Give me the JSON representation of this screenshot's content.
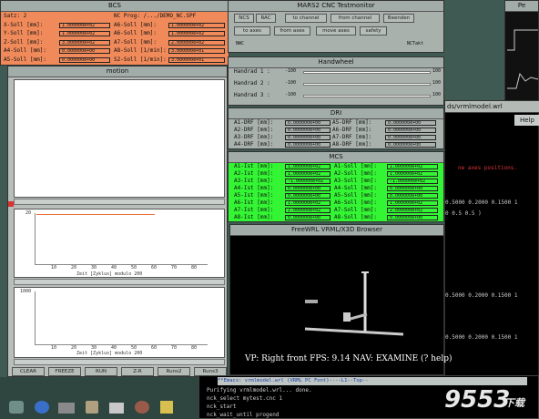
{
  "bcs": {
    "title": "BCS",
    "rows": [
      {
        "l1": "Satz: 2",
        "v1": "",
        "l2": "NC Prog: /.../DEMO_NC.SPF",
        "v2": ""
      },
      {
        "l1": "X-Soll [mm]:",
        "v1": "1.000000e+02",
        "l2": "A6-Soll [mm]:",
        "v2": "1.000000e+02"
      },
      {
        "l1": "Y-Soll [mm]:",
        "v1": "1.000000e+02",
        "l2": "A6-Soll [mm]:",
        "v2": "1.000000e+02"
      },
      {
        "l1": "Z-Soll [mm]:",
        "v1": "3.000000e+02",
        "l2": "A7-Soll [mm]:",
        "v2": "2.000000e+02"
      },
      {
        "l1": "A4-Soll [mm]:",
        "v1": "0.000000e+00",
        "l2": "A8-Soll [1/min]:",
        "v2": "3.000000e+01"
      },
      {
        "l1": "A5-Soll [mm]:",
        "v1": "0.000000e+00",
        "l2": "S2-Soll [1/min]:",
        "v2": "3.000000e+01"
      }
    ]
  },
  "testmonitor": {
    "title": "MARS2 CNC Testmonitor",
    "buttons_row1": [
      "NCS",
      "RAC",
      "to channel",
      "from channel",
      "Beenden"
    ],
    "buttons_row2": [
      "to axes",
      "from axes",
      "move axes",
      "safety"
    ],
    "corner_left": "NWC",
    "corner_right": "NCTakt"
  },
  "handwheel": {
    "title": "Handwheel",
    "rows": [
      {
        "label": "Handrad 1 :",
        "min": "-100",
        "max": "100"
      },
      {
        "label": "Handrad 2 :",
        "min": "-100",
        "max": "100"
      },
      {
        "label": "Handrad 3 :",
        "min": "-100",
        "max": "100"
      }
    ]
  },
  "dri": {
    "title": "DRI",
    "rows": [
      {
        "l1": "A1-DRF [mm]:",
        "v1": "0.000000e+00",
        "l2": "A5-DRF [mm]:",
        "v2": "0.000000e+00"
      },
      {
        "l1": "A2-DRF [mm]:",
        "v1": "0.000000e+00",
        "l2": "A6-DRF [mm]:",
        "v2": "0.000000e+00"
      },
      {
        "l1": "A3-DRF [mm]:",
        "v1": "0.000000e+00",
        "l2": "A7-DRF [mm]:",
        "v2": "0.000000e+00"
      },
      {
        "l1": "A4-DRF [mm]:",
        "v1": "0.000000e+00",
        "l2": "A8-DRF [mm]:",
        "v2": "0.000000e+00"
      }
    ]
  },
  "mcs": {
    "title": "MCS",
    "rows": [
      {
        "l1": "A1-Ist [mm]:",
        "v1": "1.000000e+02",
        "l2": "A1-Soll [mm]:",
        "v2": "1.000000e+02"
      },
      {
        "l1": "A2-Ist [mm]:",
        "v1": "1.000000e+02",
        "l2": "A2-Soll [mm]:",
        "v2": "1.000000e+02"
      },
      {
        "l1": "A3-Ist [mm]:",
        "v1": "-1.000000e+02",
        "l2": "A3-Soll [mm]:",
        "v2": "-1.000000e+02"
      },
      {
        "l1": "A4-Ist [mm]:",
        "v1": "0.000000e+00",
        "l2": "A4-Soll [mm]:",
        "v2": "0.000000e+00"
      },
      {
        "l1": "A5-Ist [mm]:",
        "v1": "0.000000e+00",
        "l2": "A5-Soll [mm]:",
        "v2": "0.000000e+00"
      },
      {
        "l1": "A6-Ist [mm]:",
        "v1": "1.000000e+02",
        "l2": "A6-Soll [mm]:",
        "v2": "1.000000e+02"
      },
      {
        "l1": "A7-Ist [mm]:",
        "v1": "2.000000e+02",
        "l2": "A7-Soll [mm]:",
        "v2": "2.000000e+02"
      },
      {
        "l1": "A8-Ist [mm]:",
        "v1": "0.000000e+00",
        "l2": "A8-Soll [mm]:",
        "v2": "0.000000e+00"
      }
    ]
  },
  "motion": {
    "title": "motion",
    "plot1": {
      "xlabel": "Zeit [Zyklus] modulo 200",
      "xticks": [
        "10",
        "20",
        "30",
        "40",
        "50",
        "60",
        "70",
        "80"
      ],
      "ytick": "20"
    },
    "plot2": {
      "xlabel": "Zeit [Zyklus] modulo 200",
      "xticks": [
        "10",
        "20",
        "30",
        "40",
        "50",
        "60",
        "70",
        "80"
      ],
      "ytick": "1000"
    },
    "bottom_buttons": [
      "CLEAR",
      "FREEZE",
      "RUN",
      "Z-R",
      "Runs2",
      "Runs3"
    ]
  },
  "vrml": {
    "title": "FreeWRL VRML/X3D Browser",
    "status": "VP: Right front   FPS: 9.14  NAV: EXAMINE  (? help)"
  },
  "rightpanel": {
    "title_fragment": "ds/vrmlmodel.wrl",
    "help": "Help",
    "red_text": "ne axes positions.",
    "lines": [
      "0.5000  0.2000  0.1500  1",
      "0 0.5 0.5 )",
      "0.5000  0.2000  0.1500  1",
      "0.5000  0.2000  0.1500  1"
    ]
  },
  "topright": {
    "title": "Pe"
  },
  "terminal": {
    "status_bar": "**Emacs: vrmlmodel.wrl    (VRML PC Font)----L1--Top--",
    "lines": [
      "Purifying vrmlmodel.wrl... done.",
      "nck_select mytest.cnc 1",
      "nck_start",
      "nck_wait_until progend"
    ]
  },
  "watermark": {
    "text": "9553",
    "sub": "下载"
  },
  "colors": {
    "bcs": "#f08a5a",
    "mcs": "#33f533",
    "panel": "#a9b1ad",
    "desktop": "#3f5a52",
    "plot_line": "#e8703a"
  }
}
